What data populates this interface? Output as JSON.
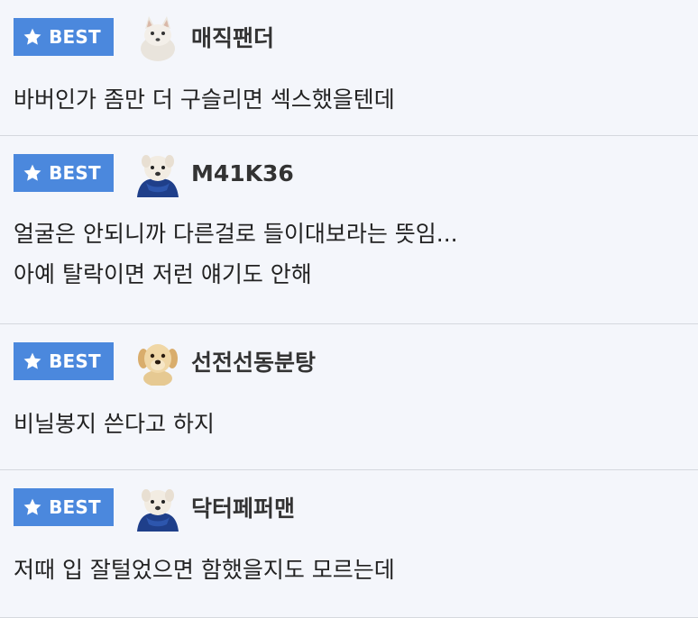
{
  "badge_label": "BEST",
  "colors": {
    "badge": "#4b88dd",
    "background": "#f4f6fb",
    "divider": "#d5d8de"
  },
  "comments": [
    {
      "username": "매직팬더",
      "avatar_icon": "white-fox-avatar-icon",
      "lines": [
        "바버인가 좀만 더 구슬리면 섹스했을텐데"
      ]
    },
    {
      "username": "M41K36",
      "avatar_icon": "white-dog-scarf-avatar-icon",
      "lines": [
        "얼굴은 안되니까 다른걸로 들이대보라는 뜻임...",
        "아예 탈락이면 저런 얘기도 안해"
      ]
    },
    {
      "username": "선전선동분탕",
      "avatar_icon": "golden-puppy-avatar-icon",
      "lines": [
        "비닐봉지 쓴다고 하지"
      ]
    },
    {
      "username": "닥터페퍼맨",
      "avatar_icon": "white-dog-scarf-avatar-icon",
      "lines": [
        "저때 입 잘털었으면 함했을지도 모르는데"
      ]
    }
  ]
}
